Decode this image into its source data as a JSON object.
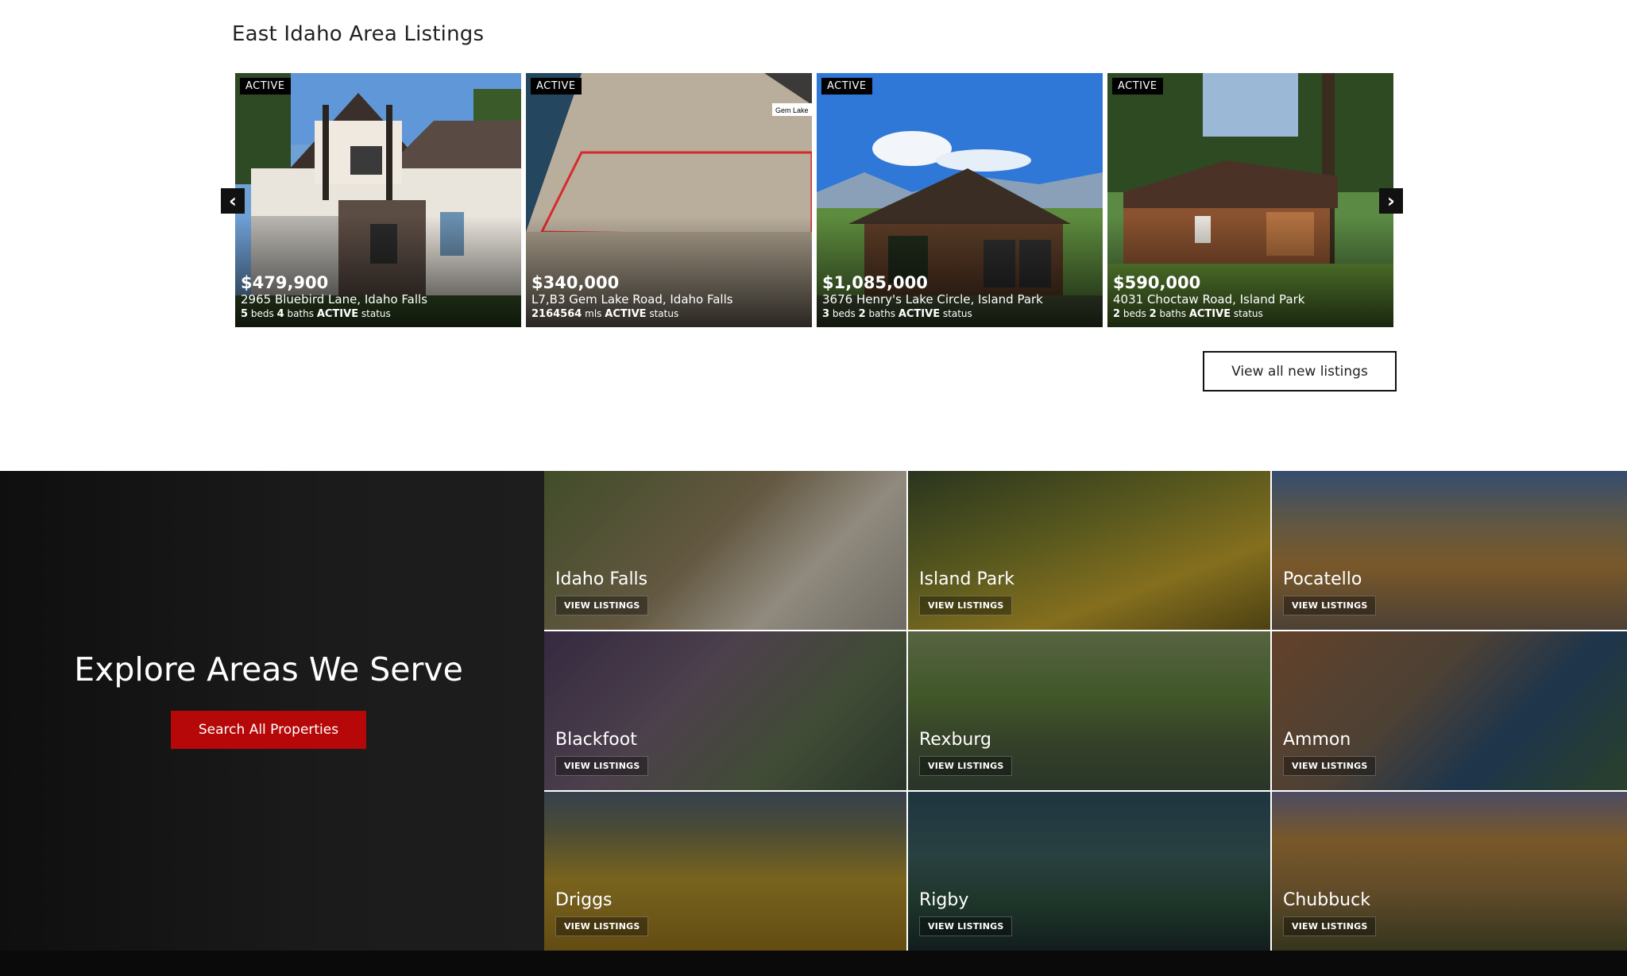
{
  "listings": {
    "title": "East Idaho Area Listings",
    "prev_icon": "chevron-left-icon",
    "next_icon": "chevron-right-icon",
    "cards": [
      {
        "badge": "ACTIVE",
        "price": "$479,900",
        "address": "2965 Bluebird Lane, Idaho Falls",
        "stat1_value": "5",
        "stat1_label": "beds",
        "stat2_value": "4",
        "stat2_label": "baths",
        "status_value": "ACTIVE",
        "status_label": "status"
      },
      {
        "badge": "ACTIVE",
        "price": "$340,000",
        "address": "L7,B3 Gem Lake Road, Idaho Falls",
        "stat1_value": "2164564",
        "stat1_label": "mls",
        "stat2_value": "",
        "stat2_label": "",
        "status_value": "ACTIVE",
        "status_label": "status",
        "photo_text": "Gem Lake"
      },
      {
        "badge": "ACTIVE",
        "price": "$1,085,000",
        "address": "3676 Henry's Lake Circle, Island Park",
        "stat1_value": "3",
        "stat1_label": "beds",
        "stat2_value": "2",
        "stat2_label": "baths",
        "status_value": "ACTIVE",
        "status_label": "status"
      },
      {
        "badge": "ACTIVE",
        "price": "$590,000",
        "address": "4031 Choctaw Road, Island Park",
        "stat1_value": "2",
        "stat1_label": "beds",
        "stat2_value": "2",
        "stat2_label": "baths",
        "status_value": "ACTIVE",
        "status_label": "status"
      }
    ],
    "view_all_label": "View all new listings"
  },
  "explore": {
    "title": "Explore Areas We Serve",
    "search_label": "Search All Properties",
    "tile_button_label": "VIEW LISTINGS",
    "areas": [
      "Idaho Falls",
      "Island Park",
      "Pocatello",
      "Blackfoot",
      "Rexburg",
      "Ammon",
      "Driggs",
      "Rigby",
      "Chubbuck"
    ]
  },
  "colors": {
    "accent": "#b60808",
    "dark_panel": "#1b1b1b"
  }
}
